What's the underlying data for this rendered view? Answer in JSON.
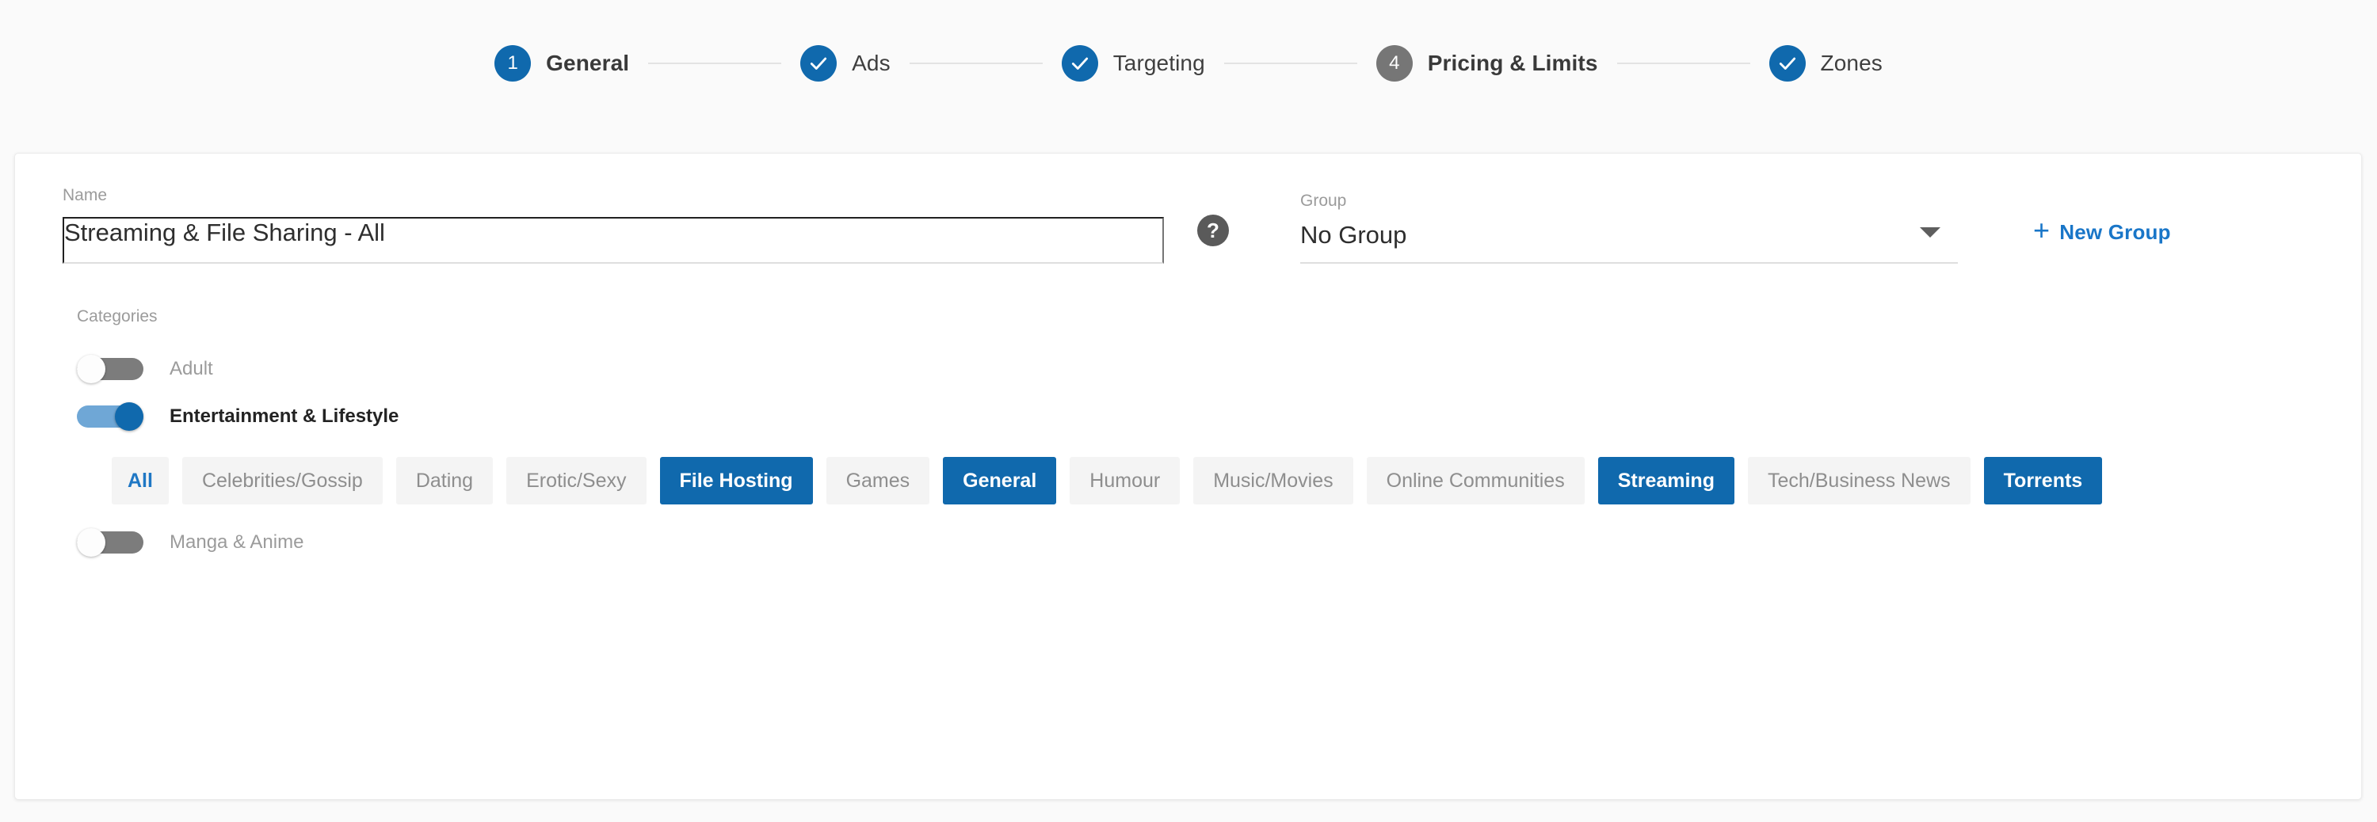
{
  "stepper": {
    "steps": [
      {
        "id": "general",
        "badge": "1",
        "label": "General",
        "state": "active",
        "icon": "number-badge"
      },
      {
        "id": "ads",
        "badge": "",
        "label": "Ads",
        "state": "done",
        "icon": "check-icon"
      },
      {
        "id": "targeting",
        "badge": "",
        "label": "Targeting",
        "state": "done",
        "icon": "check-icon"
      },
      {
        "id": "pricing-limits",
        "badge": "4",
        "label": "Pricing & Limits",
        "state": "inactive",
        "icon": "number-badge"
      },
      {
        "id": "zones",
        "badge": "",
        "label": "Zones",
        "state": "done",
        "icon": "check-icon"
      }
    ]
  },
  "form": {
    "name_label": "Name",
    "name_value": "Streaming & File Sharing - All",
    "name_placeholder": "Name",
    "help_icon_glyph": "?",
    "group_label": "Group",
    "group_value": "No Group",
    "new_group_label": "New Group",
    "plus_glyph": "+"
  },
  "categories": {
    "section_label": "Categories",
    "toggles": [
      {
        "id": "adult",
        "label": "Adult",
        "state": "off"
      },
      {
        "id": "entertainment-lifestyle",
        "label": "Entertainment & Lifestyle",
        "state": "on"
      },
      {
        "id": "manga-anime",
        "label": "Manga & Anime",
        "state": "off"
      }
    ],
    "chips": [
      {
        "label": "All",
        "state": "all"
      },
      {
        "label": "Celebrities/Gossip",
        "state": "unselected"
      },
      {
        "label": "Dating",
        "state": "unselected"
      },
      {
        "label": "Erotic/Sexy",
        "state": "unselected"
      },
      {
        "label": "File Hosting",
        "state": "selected"
      },
      {
        "label": "Games",
        "state": "unselected"
      },
      {
        "label": "General",
        "state": "selected"
      },
      {
        "label": "Humour",
        "state": "unselected"
      },
      {
        "label": "Music/Movies",
        "state": "unselected"
      },
      {
        "label": "Online Communities",
        "state": "unselected"
      },
      {
        "label": "Streaming",
        "state": "selected"
      },
      {
        "label": "Tech/Business News",
        "state": "unselected"
      },
      {
        "label": "Torrents",
        "state": "selected"
      }
    ]
  },
  "colors": {
    "accent_blue": "#1069ad",
    "link_blue": "#1976c8",
    "inactive_gray": "#767676",
    "page_bg": "#fafafa",
    "chip_bg": "#f4f4f4"
  }
}
